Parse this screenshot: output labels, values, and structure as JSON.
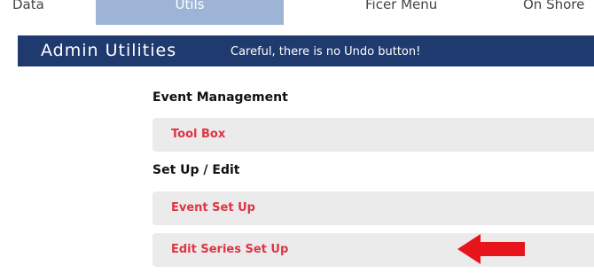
{
  "nav": {
    "tabs": [
      {
        "label": "Data"
      },
      {
        "label": "Utils"
      },
      {
        "label": "Ficer Menu"
      },
      {
        "label": "On Shore"
      }
    ]
  },
  "admin": {
    "title": "Admin Utilities",
    "warning": "Careful, there is no Undo button!"
  },
  "sections": [
    {
      "heading": "Event Management",
      "items": [
        {
          "label": "Tool Box"
        }
      ]
    },
    {
      "heading": "Set Up / Edit",
      "items": [
        {
          "label": "Event Set Up"
        },
        {
          "label": "Edit Series Set Up"
        }
      ]
    }
  ],
  "colors": {
    "admin_bar": "#1f3a6e",
    "active_tab": "#9db4d6",
    "item_text": "#e03444",
    "item_bg": "#ebebeb",
    "arrow": "#e8141c"
  },
  "icons": {
    "annotation": "red-arrow-left"
  }
}
